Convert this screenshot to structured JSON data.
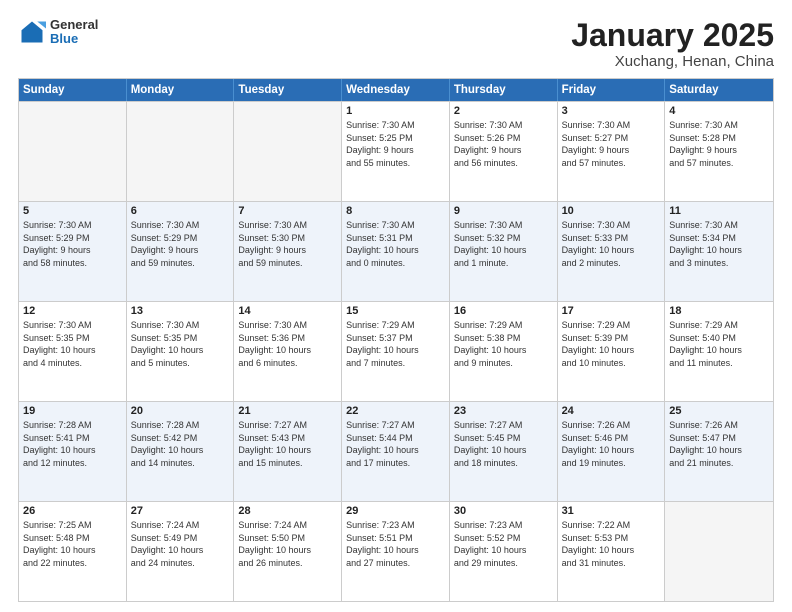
{
  "header": {
    "logo": {
      "general": "General",
      "blue": "Blue"
    },
    "title": "January 2025",
    "subtitle": "Xuchang, Henan, China"
  },
  "weekdays": [
    "Sunday",
    "Monday",
    "Tuesday",
    "Wednesday",
    "Thursday",
    "Friday",
    "Saturday"
  ],
  "rows": [
    {
      "alt": false,
      "cells": [
        {
          "empty": true
        },
        {
          "empty": true
        },
        {
          "empty": true
        },
        {
          "day": "1",
          "lines": [
            "Sunrise: 7:30 AM",
            "Sunset: 5:25 PM",
            "Daylight: 9 hours",
            "and 55 minutes."
          ]
        },
        {
          "day": "2",
          "lines": [
            "Sunrise: 7:30 AM",
            "Sunset: 5:26 PM",
            "Daylight: 9 hours",
            "and 56 minutes."
          ]
        },
        {
          "day": "3",
          "lines": [
            "Sunrise: 7:30 AM",
            "Sunset: 5:27 PM",
            "Daylight: 9 hours",
            "and 57 minutes."
          ]
        },
        {
          "day": "4",
          "lines": [
            "Sunrise: 7:30 AM",
            "Sunset: 5:28 PM",
            "Daylight: 9 hours",
            "and 57 minutes."
          ]
        }
      ]
    },
    {
      "alt": true,
      "cells": [
        {
          "day": "5",
          "lines": [
            "Sunrise: 7:30 AM",
            "Sunset: 5:29 PM",
            "Daylight: 9 hours",
            "and 58 minutes."
          ]
        },
        {
          "day": "6",
          "lines": [
            "Sunrise: 7:30 AM",
            "Sunset: 5:29 PM",
            "Daylight: 9 hours",
            "and 59 minutes."
          ]
        },
        {
          "day": "7",
          "lines": [
            "Sunrise: 7:30 AM",
            "Sunset: 5:30 PM",
            "Daylight: 9 hours",
            "and 59 minutes."
          ]
        },
        {
          "day": "8",
          "lines": [
            "Sunrise: 7:30 AM",
            "Sunset: 5:31 PM",
            "Daylight: 10 hours",
            "and 0 minutes."
          ]
        },
        {
          "day": "9",
          "lines": [
            "Sunrise: 7:30 AM",
            "Sunset: 5:32 PM",
            "Daylight: 10 hours",
            "and 1 minute."
          ]
        },
        {
          "day": "10",
          "lines": [
            "Sunrise: 7:30 AM",
            "Sunset: 5:33 PM",
            "Daylight: 10 hours",
            "and 2 minutes."
          ]
        },
        {
          "day": "11",
          "lines": [
            "Sunrise: 7:30 AM",
            "Sunset: 5:34 PM",
            "Daylight: 10 hours",
            "and 3 minutes."
          ]
        }
      ]
    },
    {
      "alt": false,
      "cells": [
        {
          "day": "12",
          "lines": [
            "Sunrise: 7:30 AM",
            "Sunset: 5:35 PM",
            "Daylight: 10 hours",
            "and 4 minutes."
          ]
        },
        {
          "day": "13",
          "lines": [
            "Sunrise: 7:30 AM",
            "Sunset: 5:35 PM",
            "Daylight: 10 hours",
            "and 5 minutes."
          ]
        },
        {
          "day": "14",
          "lines": [
            "Sunrise: 7:30 AM",
            "Sunset: 5:36 PM",
            "Daylight: 10 hours",
            "and 6 minutes."
          ]
        },
        {
          "day": "15",
          "lines": [
            "Sunrise: 7:29 AM",
            "Sunset: 5:37 PM",
            "Daylight: 10 hours",
            "and 7 minutes."
          ]
        },
        {
          "day": "16",
          "lines": [
            "Sunrise: 7:29 AM",
            "Sunset: 5:38 PM",
            "Daylight: 10 hours",
            "and 9 minutes."
          ]
        },
        {
          "day": "17",
          "lines": [
            "Sunrise: 7:29 AM",
            "Sunset: 5:39 PM",
            "Daylight: 10 hours",
            "and 10 minutes."
          ]
        },
        {
          "day": "18",
          "lines": [
            "Sunrise: 7:29 AM",
            "Sunset: 5:40 PM",
            "Daylight: 10 hours",
            "and 11 minutes."
          ]
        }
      ]
    },
    {
      "alt": true,
      "cells": [
        {
          "day": "19",
          "lines": [
            "Sunrise: 7:28 AM",
            "Sunset: 5:41 PM",
            "Daylight: 10 hours",
            "and 12 minutes."
          ]
        },
        {
          "day": "20",
          "lines": [
            "Sunrise: 7:28 AM",
            "Sunset: 5:42 PM",
            "Daylight: 10 hours",
            "and 14 minutes."
          ]
        },
        {
          "day": "21",
          "lines": [
            "Sunrise: 7:27 AM",
            "Sunset: 5:43 PM",
            "Daylight: 10 hours",
            "and 15 minutes."
          ]
        },
        {
          "day": "22",
          "lines": [
            "Sunrise: 7:27 AM",
            "Sunset: 5:44 PM",
            "Daylight: 10 hours",
            "and 17 minutes."
          ]
        },
        {
          "day": "23",
          "lines": [
            "Sunrise: 7:27 AM",
            "Sunset: 5:45 PM",
            "Daylight: 10 hours",
            "and 18 minutes."
          ]
        },
        {
          "day": "24",
          "lines": [
            "Sunrise: 7:26 AM",
            "Sunset: 5:46 PM",
            "Daylight: 10 hours",
            "and 19 minutes."
          ]
        },
        {
          "day": "25",
          "lines": [
            "Sunrise: 7:26 AM",
            "Sunset: 5:47 PM",
            "Daylight: 10 hours",
            "and 21 minutes."
          ]
        }
      ]
    },
    {
      "alt": false,
      "cells": [
        {
          "day": "26",
          "lines": [
            "Sunrise: 7:25 AM",
            "Sunset: 5:48 PM",
            "Daylight: 10 hours",
            "and 22 minutes."
          ]
        },
        {
          "day": "27",
          "lines": [
            "Sunrise: 7:24 AM",
            "Sunset: 5:49 PM",
            "Daylight: 10 hours",
            "and 24 minutes."
          ]
        },
        {
          "day": "28",
          "lines": [
            "Sunrise: 7:24 AM",
            "Sunset: 5:50 PM",
            "Daylight: 10 hours",
            "and 26 minutes."
          ]
        },
        {
          "day": "29",
          "lines": [
            "Sunrise: 7:23 AM",
            "Sunset: 5:51 PM",
            "Daylight: 10 hours",
            "and 27 minutes."
          ]
        },
        {
          "day": "30",
          "lines": [
            "Sunrise: 7:23 AM",
            "Sunset: 5:52 PM",
            "Daylight: 10 hours",
            "and 29 minutes."
          ]
        },
        {
          "day": "31",
          "lines": [
            "Sunrise: 7:22 AM",
            "Sunset: 5:53 PM",
            "Daylight: 10 hours",
            "and 31 minutes."
          ]
        },
        {
          "empty": true
        }
      ]
    }
  ]
}
